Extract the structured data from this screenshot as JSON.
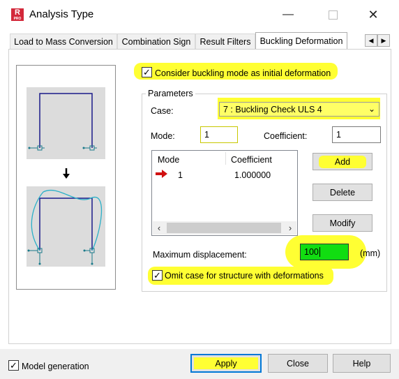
{
  "window": {
    "title": "Analysis Type",
    "app_icon_letter": "R",
    "app_icon_sub": "PRO"
  },
  "tabs": [
    {
      "label": "Load to Mass Conversion"
    },
    {
      "label": "Combination Sign"
    },
    {
      "label": "Result Filters"
    },
    {
      "label": "Buckling Deformation"
    }
  ],
  "tab_scroll": {
    "left": "◀",
    "right": "▶"
  },
  "options": {
    "consider_buckling_label": "Consider buckling mode as initial deformation",
    "consider_buckling_checked": true,
    "omit_case_label": "Omit case for structure with deformations",
    "omit_case_checked": true
  },
  "parameters": {
    "group_label": "Parameters",
    "case_label": "Case:",
    "case_value": "7 : Buckling Check ULS 4",
    "mode_label": "Mode:",
    "mode_value": "1",
    "coefficient_label": "Coefficient:",
    "coefficient_value": "1",
    "table": {
      "headers": [
        "Mode",
        "Coefficient"
      ],
      "rows": [
        {
          "mode": "1",
          "coefficient": "1.000000"
        }
      ]
    },
    "add_label": "Add",
    "delete_label": "Delete",
    "modify_label": "Modify",
    "max_disp_label": "Maximum displacement:",
    "max_disp_value": "100",
    "max_disp_unit": "(mm)"
  },
  "footer": {
    "model_generation_label": "Model generation",
    "model_generation_checked": true,
    "apply_label": "Apply",
    "close_label": "Close",
    "help_label": "Help"
  },
  "colors": {
    "highlight": "#ffff33",
    "green_field": "#11dd11",
    "frame_line": "#1a1a8a",
    "deform_line": "#2ab0c8",
    "arrow_red": "#d01010"
  }
}
